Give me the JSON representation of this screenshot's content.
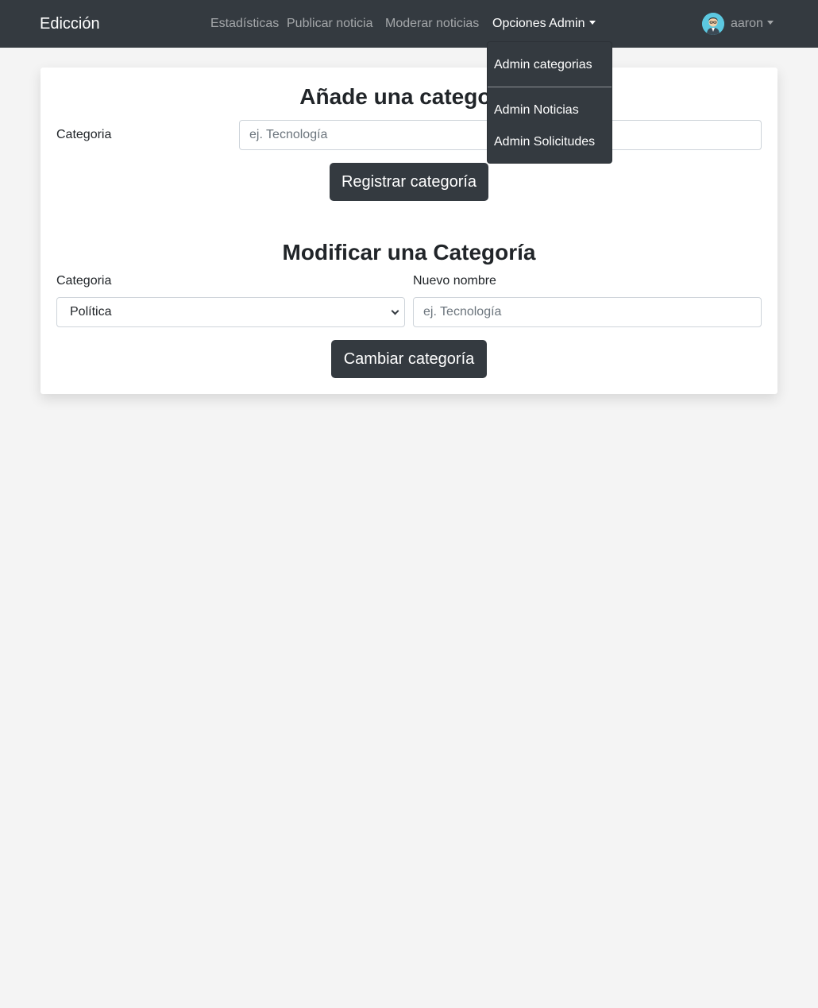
{
  "navbar": {
    "brand": "Edicción",
    "links": [
      "Estadísticas",
      "Publicar noticia",
      "Moderar noticias"
    ],
    "admin_menu_label": "Opciones Admin",
    "user_name": "aaron"
  },
  "dropdown": {
    "items": [
      "Admin categorias",
      "Admin Noticias",
      "Admin Solicitudes"
    ]
  },
  "add_section": {
    "title": "Añade una categoría",
    "label": "Categoria",
    "placeholder": "ej. Tecnología",
    "button": "Registrar categoría"
  },
  "modify_section": {
    "title": "Modificar una Categoría",
    "category_label": "Categoria",
    "category_selected": "Política",
    "new_name_label": "Nuevo nombre",
    "new_name_placeholder": "ej. Tecnología",
    "button": "Cambiar categoría"
  },
  "colors": {
    "navbar_bg": "#343a40",
    "button_bg": "#343a40",
    "page_bg": "#f4f4f4"
  }
}
